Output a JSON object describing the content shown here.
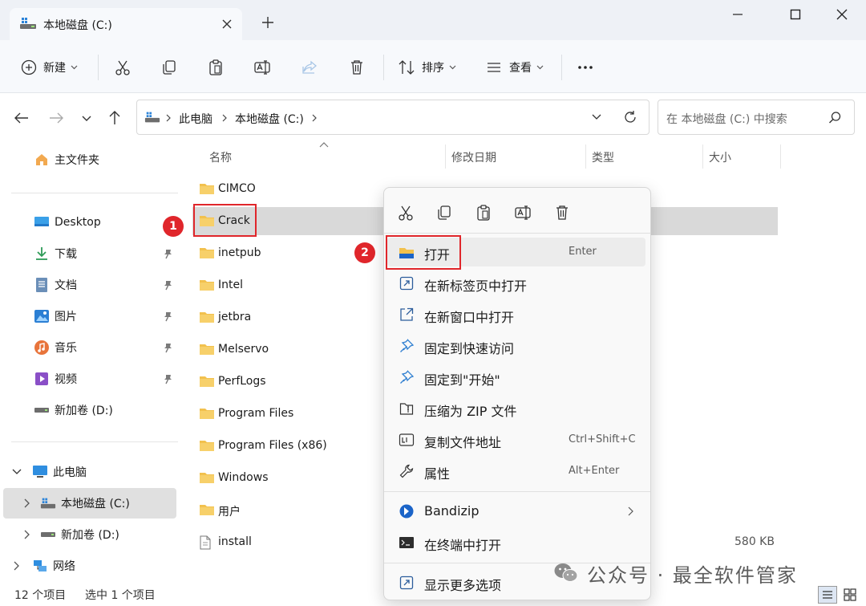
{
  "window": {
    "tab_title": "本地磁盘 (C:)"
  },
  "toolbar": {
    "new_label": "新建",
    "sort_label": "排序",
    "view_label": "查看"
  },
  "address": {
    "crumbs": [
      "此电脑",
      "本地磁盘 (C:)"
    ],
    "search_placeholder": "在 本地磁盘 (C:) 中搜索"
  },
  "sidebar": {
    "home": "主文件夹",
    "desktop": "Desktop",
    "downloads": "下载",
    "documents": "文档",
    "pictures": "图片",
    "music": "音乐",
    "videos": "视频",
    "volume_d": "新加卷 (D:)",
    "this_pc": "此电脑",
    "local_c": "本地磁盘 (C:)",
    "volume_d2": "新加卷 (D:)",
    "network": "网络"
  },
  "columns": {
    "name": "名称",
    "modified": "修改日期",
    "type": "类型",
    "size": "大小"
  },
  "files": [
    {
      "name": "CIMCO"
    },
    {
      "name": "Crack"
    },
    {
      "name": "inetpub"
    },
    {
      "name": "Intel"
    },
    {
      "name": "jetbra"
    },
    {
      "name": "Melservo"
    },
    {
      "name": "PerfLogs"
    },
    {
      "name": "Program Files"
    },
    {
      "name": "Program Files (x86)"
    },
    {
      "name": "Windows"
    },
    {
      "name": "用户"
    },
    {
      "name": "install",
      "size": "580 KB"
    }
  ],
  "context_menu": {
    "items": [
      {
        "label": "打开",
        "key": "Enter"
      },
      {
        "label": "在新标签页中打开"
      },
      {
        "label": "在新窗口中打开"
      },
      {
        "label": "固定到快速访问"
      },
      {
        "label": "固定到\"开始\""
      },
      {
        "label": "压缩为 ZIP 文件"
      },
      {
        "label": "复制文件地址",
        "key": "Ctrl+Shift+C"
      },
      {
        "label": "属性",
        "key": "Alt+Enter"
      },
      {
        "label": "Bandizip"
      },
      {
        "label": "在终端中打开"
      },
      {
        "label": "显示更多选项"
      }
    ]
  },
  "annotations": {
    "badge1": "1",
    "badge2": "2",
    "color": "#e0262b"
  },
  "status": {
    "count": "12 个项目",
    "selected": "选中 1 个项目"
  },
  "watermark": {
    "text": "公众号 · 最全软件管家"
  },
  "colors": {
    "folder": "#f2c14e",
    "accent": "#0067c0",
    "selection": "#d9d9d9"
  }
}
